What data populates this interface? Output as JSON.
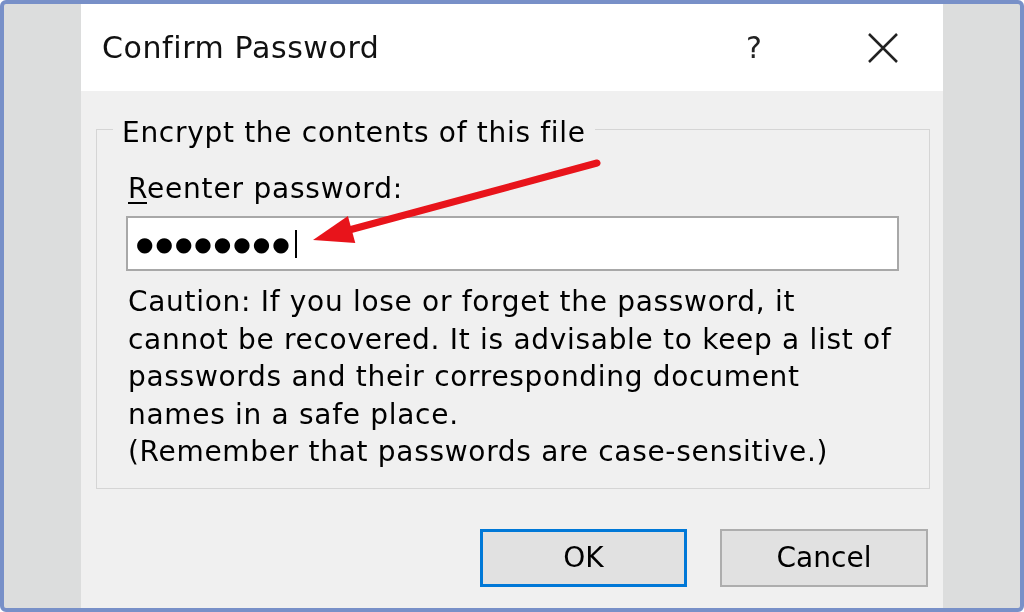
{
  "window": {
    "title": "Confirm Password",
    "help_button": "?"
  },
  "group": {
    "title": "Encrypt the contents of this file",
    "field": {
      "label": "Reenter password:",
      "access_key_underlined": true,
      "value": "●●●●●●●●",
      "focused": true
    },
    "caution": "Caution: If you lose or forget the password, it cannot be recovered. It is advisable to keep a list of passwords and their corresponding document names in a safe place.",
    "note": "(Remember that passwords are case-sensitive.)"
  },
  "buttons": [
    {
      "label": "OK",
      "default": true
    },
    {
      "label": "Cancel",
      "default": false
    }
  ],
  "annotations": [
    {
      "kind": "arrow"
    }
  ]
}
